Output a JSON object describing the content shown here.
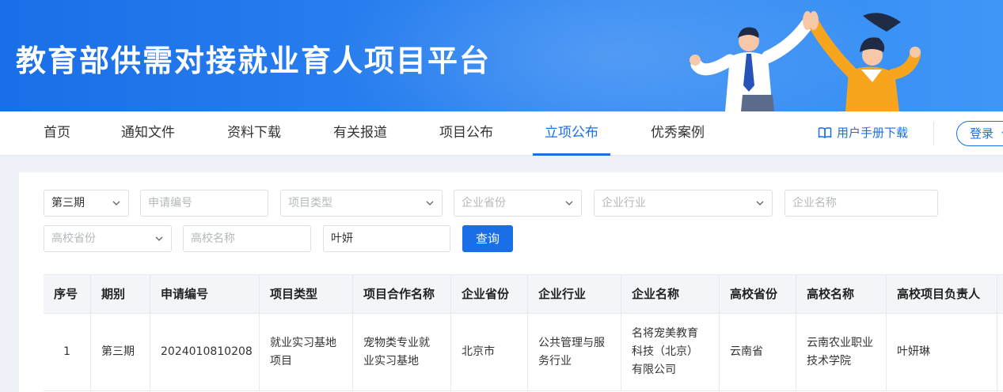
{
  "banner": {
    "title": "教育部供需对接就业育人项目平台"
  },
  "nav": {
    "items": [
      {
        "label": "首页",
        "active": false
      },
      {
        "label": "通知文件",
        "active": false
      },
      {
        "label": "资料下载",
        "active": false
      },
      {
        "label": "有关报道",
        "active": false
      },
      {
        "label": "项目公布",
        "active": false
      },
      {
        "label": "立项公布",
        "active": true
      },
      {
        "label": "优秀案例",
        "active": false
      }
    ],
    "manual_label": "用户手册下载",
    "login_label": "登录"
  },
  "filters": {
    "period": {
      "value": "第三期"
    },
    "app_no": {
      "placeholder": "申请编号"
    },
    "project_type": {
      "placeholder": "项目类型"
    },
    "company_province": {
      "placeholder": "企业省份"
    },
    "company_industry": {
      "placeholder": "企业行业"
    },
    "company_name": {
      "placeholder": "企业名称"
    },
    "school_province": {
      "placeholder": "高校省份"
    },
    "school_name": {
      "placeholder": "高校名称"
    },
    "leader": {
      "value": "叶妍"
    },
    "query_label": "查询"
  },
  "table": {
    "headers": [
      "序号",
      "期别",
      "申请编号",
      "项目类型",
      "项目合作名称",
      "企业省份",
      "企业行业",
      "企业名称",
      "高校省份",
      "高校名称",
      "高校项目负责人"
    ],
    "rows": [
      [
        "1",
        "第三期",
        "2024010810208",
        "就业实习基地项目",
        "宠物类专业就业实习基地",
        "北京市",
        "公共管理与服务行业",
        "名将宠美教育科技（北京）有限公司",
        "云南省",
        "云南农业职业技术学院",
        "叶妍琳"
      ]
    ]
  },
  "colors": {
    "primary": "#1a6ee8",
    "banner_start": "#1a6ee8",
    "banner_end": "#3f96f6"
  }
}
